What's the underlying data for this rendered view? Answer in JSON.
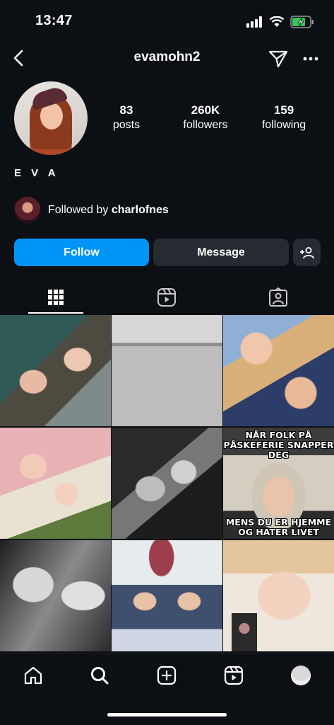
{
  "status": {
    "time": "13:47"
  },
  "header": {
    "username": "evamohn2"
  },
  "profile": {
    "stats": [
      {
        "value": "83",
        "label": "posts"
      },
      {
        "value": "260K",
        "label": "followers"
      },
      {
        "value": "159",
        "label": "following"
      }
    ],
    "name": "E V A",
    "followed_by_prefix": "Followed by ",
    "followed_by_user": "charlofnes"
  },
  "buttons": {
    "follow": "Follow",
    "message": "Message"
  },
  "tabs": [
    "grid-icon",
    "reels-icon",
    "tagged-icon"
  ],
  "grid": {
    "meme_top": "NÅR FOLK PÅ PÅSKEFERIE SNAPPER DEG",
    "meme_bottom": "MENS DU ER HJEMME OG HATER LIVET"
  },
  "bottom_nav": [
    "home-icon",
    "search-icon",
    "new-post-icon",
    "reels-icon",
    "profile-icon"
  ],
  "colors": {
    "background": "#0c0f14",
    "follow_button": "#0095f6",
    "secondary_button": "#262a31"
  }
}
